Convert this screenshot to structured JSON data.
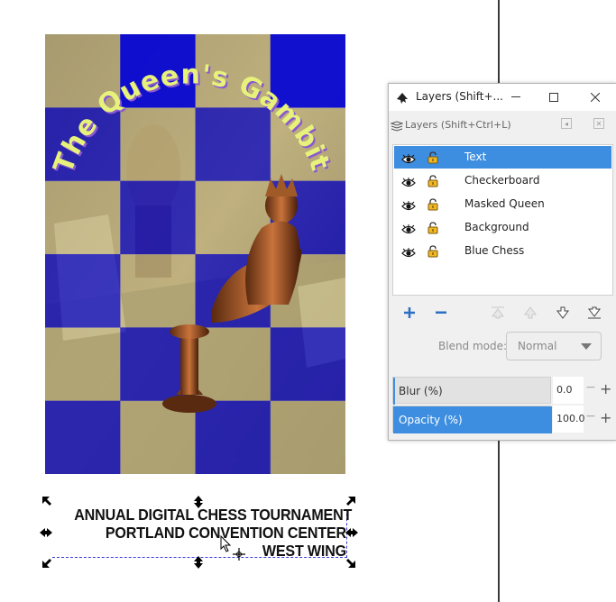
{
  "poster": {
    "title": "The Queen's Gambit"
  },
  "text_object": {
    "lines": [
      "ANNUAL DIGITAL CHESS TOURNAMENT",
      "PORTLAND CONVENTION CENTER",
      "WEST WING"
    ]
  },
  "layers_dialog": {
    "window_title": "Layers (Shift+...",
    "panel_title": "Layers (Shift+Ctrl+L)",
    "layers": [
      {
        "name": "Text",
        "selected": true
      },
      {
        "name": "Checkerboard",
        "selected": false
      },
      {
        "name": "Masked Queen",
        "selected": false
      },
      {
        "name": "Background",
        "selected": false
      },
      {
        "name": "Blue Chess",
        "selected": false
      }
    ],
    "blend_mode_label": "Blend mode:",
    "blend_mode_value": "Normal",
    "blur": {
      "label": "Blur (%)",
      "value": "0.0",
      "fraction": 0.0
    },
    "opacity": {
      "label": "Opacity (%)",
      "value": "100.0",
      "fraction": 1.0
    }
  },
  "colors": {
    "accent": "#3d8ee0",
    "checker_blue": "#0a0ad6",
    "title_text": "#e6f27a",
    "title_shadow": "#8a5ad0"
  }
}
